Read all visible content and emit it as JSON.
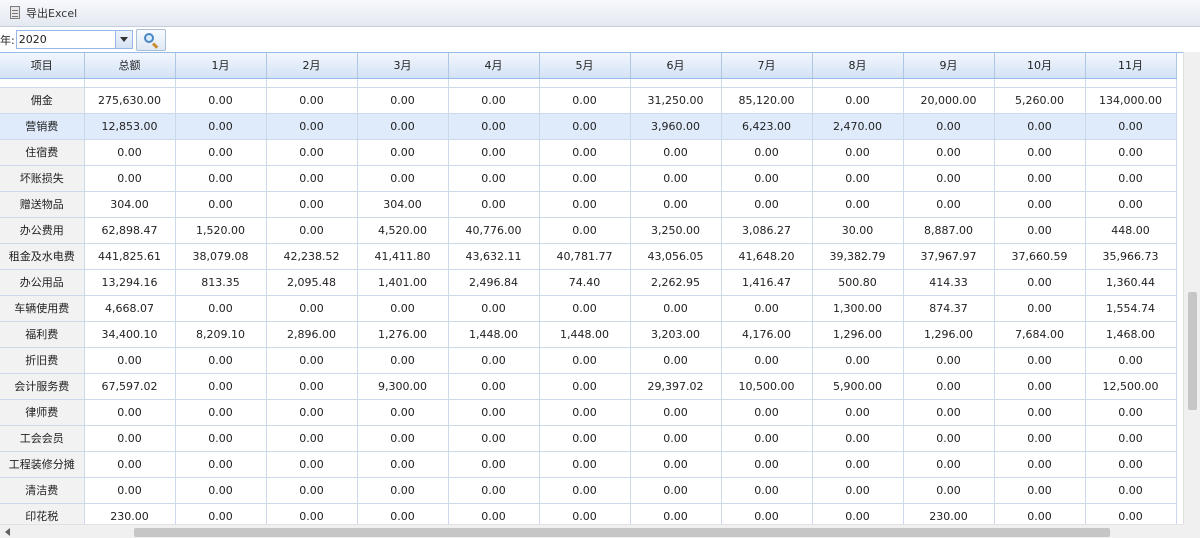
{
  "toolbar": {
    "export_label": "导出Excel"
  },
  "filter": {
    "year_label": "年:",
    "year_value": "2020"
  },
  "table": {
    "headers": [
      "项目",
      "总额",
      "1月",
      "2月",
      "3月",
      "4月",
      "5月",
      "6月",
      "7月",
      "8月",
      "9月",
      "10月",
      "11月"
    ],
    "rows": [
      [
        "佣金",
        "275,630.00",
        "0.00",
        "0.00",
        "0.00",
        "0.00",
        "0.00",
        "31,250.00",
        "85,120.00",
        "0.00",
        "20,000.00",
        "5,260.00",
        "134,000.00"
      ],
      [
        "营销费",
        "12,853.00",
        "0.00",
        "0.00",
        "0.00",
        "0.00",
        "0.00",
        "3,960.00",
        "6,423.00",
        "2,470.00",
        "0.00",
        "0.00",
        "0.00"
      ],
      [
        "住宿费",
        "0.00",
        "0.00",
        "0.00",
        "0.00",
        "0.00",
        "0.00",
        "0.00",
        "0.00",
        "0.00",
        "0.00",
        "0.00",
        "0.00"
      ],
      [
        "坏账损失",
        "0.00",
        "0.00",
        "0.00",
        "0.00",
        "0.00",
        "0.00",
        "0.00",
        "0.00",
        "0.00",
        "0.00",
        "0.00",
        "0.00"
      ],
      [
        "赠送物品",
        "304.00",
        "0.00",
        "0.00",
        "304.00",
        "0.00",
        "0.00",
        "0.00",
        "0.00",
        "0.00",
        "0.00",
        "0.00",
        "0.00"
      ],
      [
        "办公费用",
        "62,898.47",
        "1,520.00",
        "0.00",
        "4,520.00",
        "40,776.00",
        "0.00",
        "3,250.00",
        "3,086.27",
        "30.00",
        "8,887.00",
        "0.00",
        "448.00"
      ],
      [
        "租金及水电费",
        "441,825.61",
        "38,079.08",
        "42,238.52",
        "41,411.80",
        "43,632.11",
        "40,781.77",
        "43,056.05",
        "41,648.20",
        "39,382.79",
        "37,967.97",
        "37,660.59",
        "35,966.73"
      ],
      [
        "办公用品",
        "13,294.16",
        "813.35",
        "2,095.48",
        "1,401.00",
        "2,496.84",
        "74.40",
        "2,262.95",
        "1,416.47",
        "500.80",
        "414.33",
        "0.00",
        "1,360.44"
      ],
      [
        "车辆使用费",
        "4,668.07",
        "0.00",
        "0.00",
        "0.00",
        "0.00",
        "0.00",
        "0.00",
        "0.00",
        "1,300.00",
        "874.37",
        "0.00",
        "1,554.74"
      ],
      [
        "福利费",
        "34,400.10",
        "8,209.10",
        "2,896.00",
        "1,276.00",
        "1,448.00",
        "1,448.00",
        "3,203.00",
        "4,176.00",
        "1,296.00",
        "1,296.00",
        "7,684.00",
        "1,468.00"
      ],
      [
        "折旧费",
        "0.00",
        "0.00",
        "0.00",
        "0.00",
        "0.00",
        "0.00",
        "0.00",
        "0.00",
        "0.00",
        "0.00",
        "0.00",
        "0.00"
      ],
      [
        "会计服务费",
        "67,597.02",
        "0.00",
        "0.00",
        "9,300.00",
        "0.00",
        "0.00",
        "29,397.02",
        "10,500.00",
        "5,900.00",
        "0.00",
        "0.00",
        "12,500.00"
      ],
      [
        "律师费",
        "0.00",
        "0.00",
        "0.00",
        "0.00",
        "0.00",
        "0.00",
        "0.00",
        "0.00",
        "0.00",
        "0.00",
        "0.00",
        "0.00"
      ],
      [
        "工会会员",
        "0.00",
        "0.00",
        "0.00",
        "0.00",
        "0.00",
        "0.00",
        "0.00",
        "0.00",
        "0.00",
        "0.00",
        "0.00",
        "0.00"
      ],
      [
        "工程装修分摊",
        "0.00",
        "0.00",
        "0.00",
        "0.00",
        "0.00",
        "0.00",
        "0.00",
        "0.00",
        "0.00",
        "0.00",
        "0.00",
        "0.00"
      ],
      [
        "清洁费",
        "0.00",
        "0.00",
        "0.00",
        "0.00",
        "0.00",
        "0.00",
        "0.00",
        "0.00",
        "0.00",
        "0.00",
        "0.00",
        "0.00"
      ],
      [
        "印花税",
        "230.00",
        "0.00",
        "0.00",
        "0.00",
        "0.00",
        "0.00",
        "0.00",
        "0.00",
        "0.00",
        "230.00",
        "0.00",
        "0.00"
      ]
    ],
    "selected_row": 1
  }
}
